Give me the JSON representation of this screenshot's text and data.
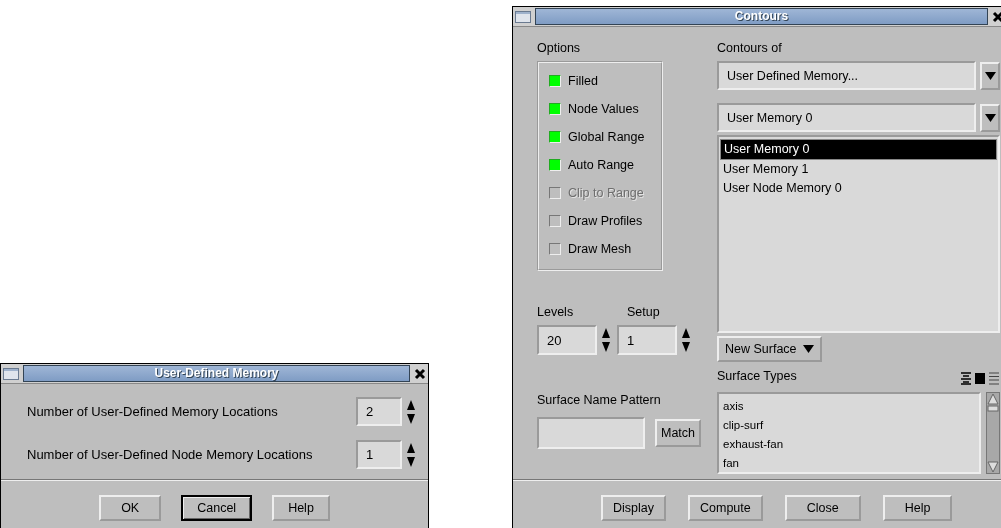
{
  "memory_dialog": {
    "title": "User-Defined Memory",
    "fields": [
      {
        "label": "Number of User-Defined Memory Locations",
        "value": "2"
      },
      {
        "label": "Number of User-Defined Node Memory Locations",
        "value": "1"
      }
    ],
    "buttons": [
      {
        "label": "OK",
        "default": false
      },
      {
        "label": "Cancel",
        "default": true
      },
      {
        "label": "Help",
        "default": false
      }
    ]
  },
  "contours_dialog": {
    "title": "Contours",
    "options_label": "Options",
    "options": [
      {
        "label": "Filled",
        "checked": true,
        "disabled": false
      },
      {
        "label": "Node Values",
        "checked": true,
        "disabled": false
      },
      {
        "label": "Global Range",
        "checked": true,
        "disabled": false
      },
      {
        "label": "Auto Range",
        "checked": true,
        "disabled": false
      },
      {
        "label": "Clip to Range",
        "checked": false,
        "disabled": true
      },
      {
        "label": "Draw Profiles",
        "checked": false,
        "disabled": false
      },
      {
        "label": "Draw Mesh",
        "checked": false,
        "disabled": false
      }
    ],
    "contours_of_label": "Contours of",
    "contours_of_value": "User Defined Memory...",
    "variable_value": "User Memory 0",
    "variable_options": [
      {
        "label": "User Memory 0",
        "selected": true
      },
      {
        "label": "User Memory 1",
        "selected": false
      },
      {
        "label": "User Node Memory 0",
        "selected": false
      }
    ],
    "levels": {
      "label": "Levels",
      "value": "20"
    },
    "setup": {
      "label": "Setup",
      "value": "1"
    },
    "new_surface_button": "New Surface",
    "surface_name_pattern_label": "Surface Name Pattern",
    "match_button": "Match",
    "surface_types_label": "Surface Types",
    "surface_types": [
      "axis",
      "clip-surf",
      "exhaust-fan",
      "fan"
    ],
    "buttons": [
      "Display",
      "Compute",
      "Close",
      "Help"
    ]
  }
}
